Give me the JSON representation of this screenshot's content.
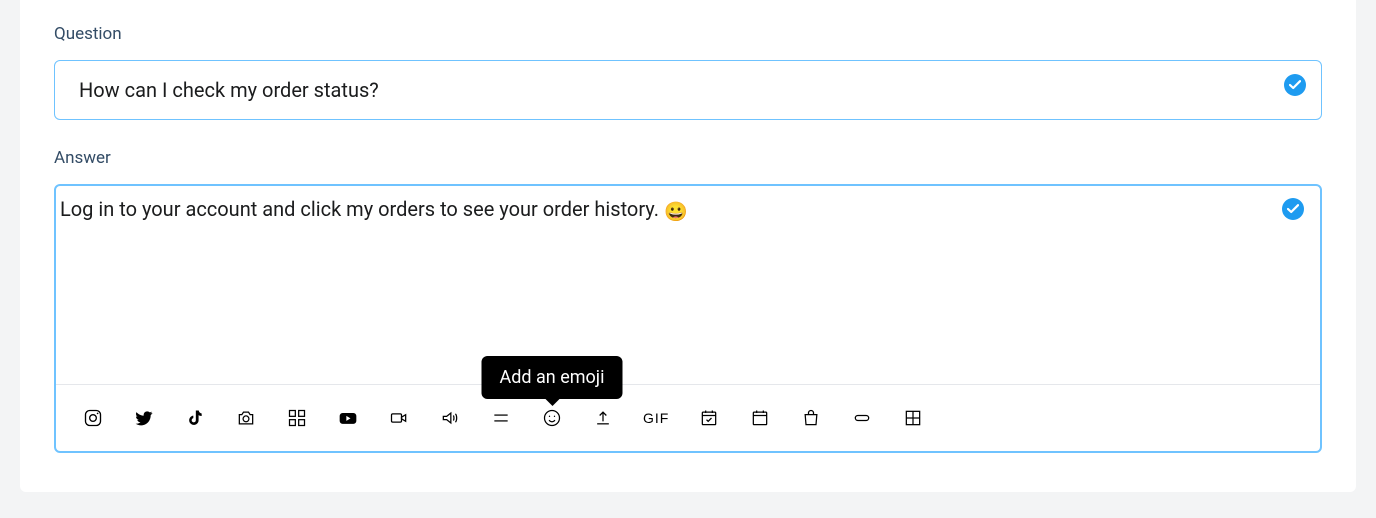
{
  "question": {
    "label": "Question",
    "value": "How can I check my order status?"
  },
  "answer": {
    "label": "Answer",
    "value_before_emoji": "Log in to your account and click my orders to see your order history. ",
    "emoji": "😀"
  },
  "tooltip": {
    "emoji": "Add an emoji"
  },
  "toolbar": {
    "gif_label": "GIF"
  }
}
